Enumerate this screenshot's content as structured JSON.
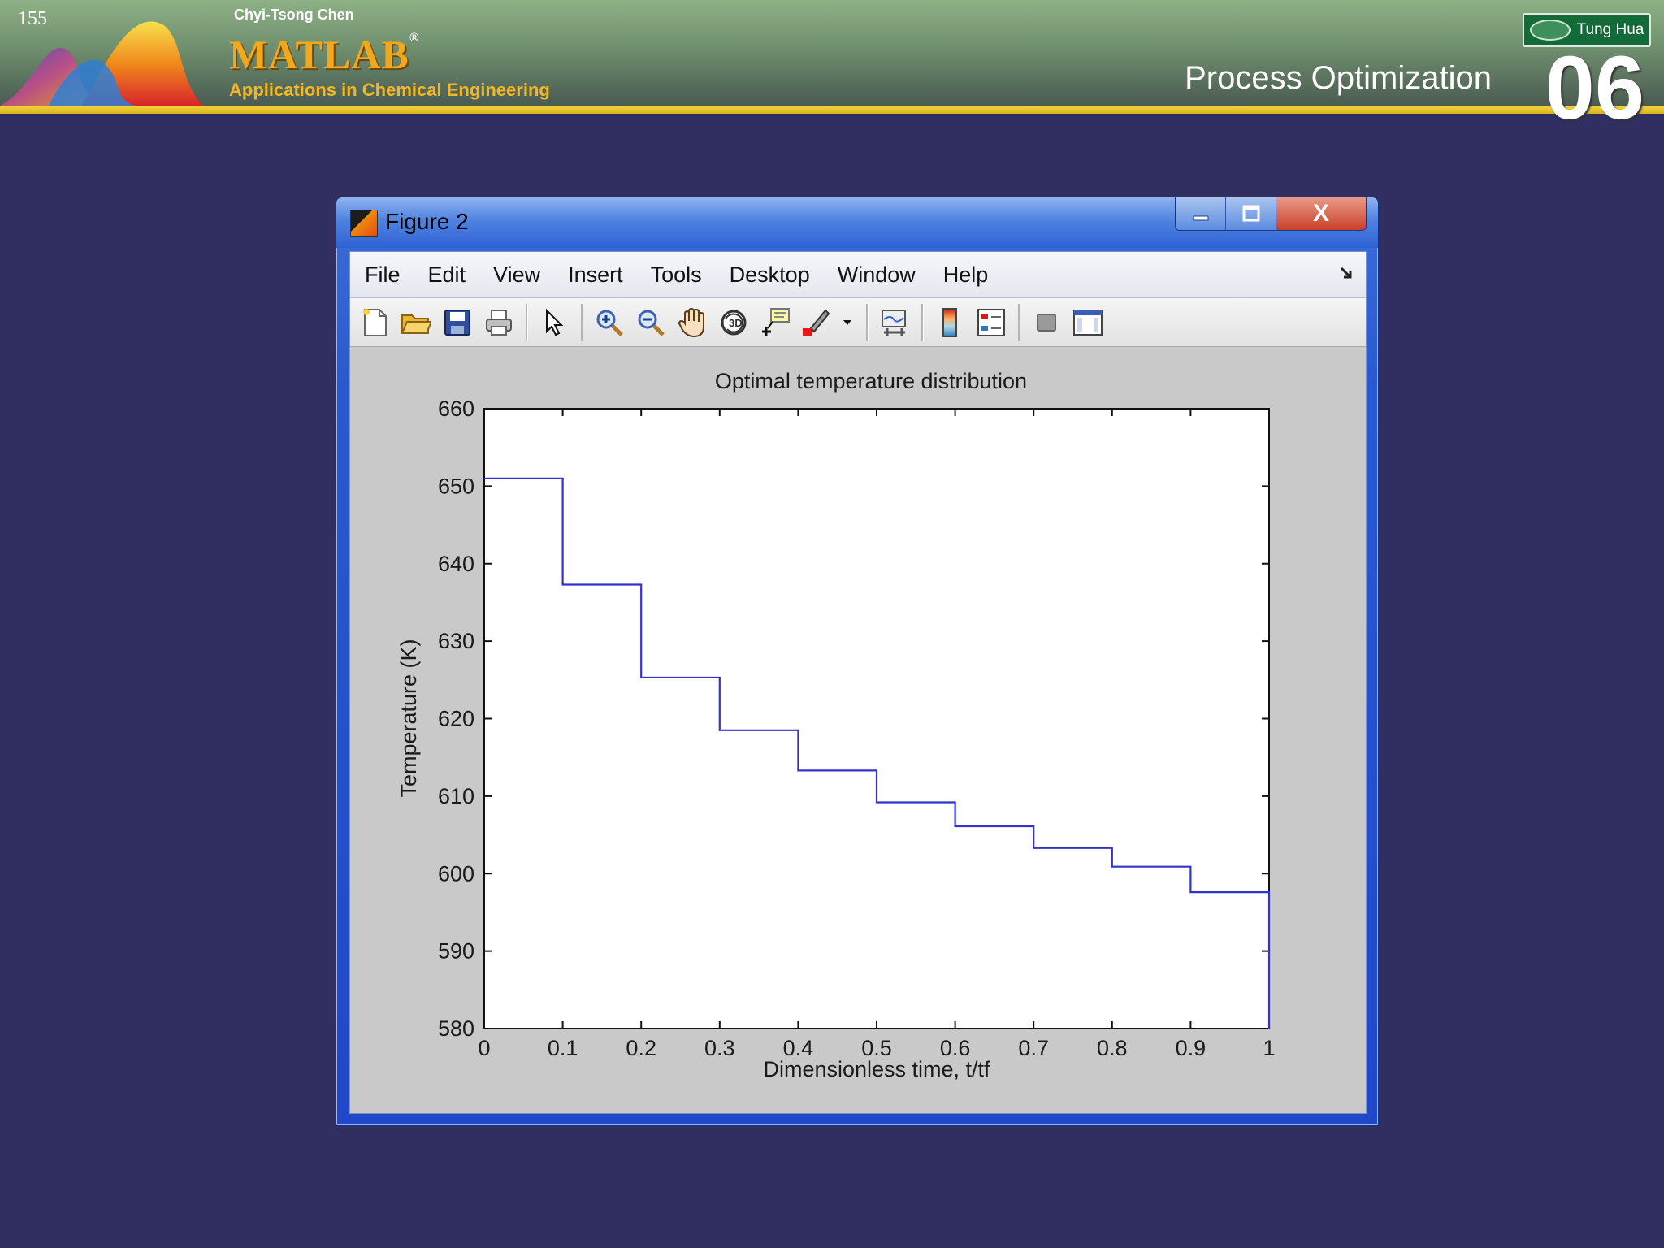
{
  "slide": {
    "page_number": "155",
    "author": "Chyi-Tsong Chen",
    "matlab_title": "MATLAB",
    "matlab_reg": "®",
    "subtitle": "Applications in Chemical Engineering",
    "section_title": "Process Optimization",
    "chapter_number": "06",
    "brand_badge": "Tung Hua"
  },
  "window": {
    "title": "Figure 2",
    "controls": {
      "minimize": "▁",
      "maximize": "☐",
      "close": "X"
    },
    "menu": [
      "File",
      "Edit",
      "View",
      "Insert",
      "Tools",
      "Desktop",
      "Window",
      "Help"
    ],
    "dock_icon": "dock-arrow-icon",
    "toolbar_icons": [
      "new-figure-icon",
      "open-file-icon",
      "save-icon",
      "print-icon",
      "edit-plot-arrow-icon",
      "zoom-in-icon",
      "zoom-out-icon",
      "pan-hand-icon",
      "rotate-3d-icon",
      "data-cursor-icon",
      "brush-icon",
      "brush-dropdown-icon",
      "link-plot-icon",
      "insert-colorbar-icon",
      "insert-legend-icon",
      "hide-plot-tools-icon",
      "show-plot-tools-icon"
    ]
  },
  "chart_data": {
    "type": "line",
    "step": true,
    "title": "Optimal temperature distribution",
    "xlabel": "Dimensionless time, t/tf",
    "ylabel": "Temperature (K)",
    "xlim": [
      0,
      1
    ],
    "ylim": [
      580,
      660
    ],
    "xticks": [
      0,
      0.1,
      0.2,
      0.3,
      0.4,
      0.5,
      0.6,
      0.7,
      0.8,
      0.9,
      1
    ],
    "xtick_labels": [
      "0",
      "0.1",
      "0.2",
      "0.3",
      "0.4",
      "0.5",
      "0.6",
      "0.7",
      "0.8",
      "0.9",
      "1"
    ],
    "yticks": [
      580,
      590,
      600,
      610,
      620,
      630,
      640,
      650,
      660
    ],
    "ytick_labels": [
      "580",
      "590",
      "600",
      "610",
      "620",
      "630",
      "640",
      "650",
      "660"
    ],
    "grid": false,
    "line_color": "#3333cc",
    "series": [
      {
        "x": [
          0,
          0.1,
          0.2,
          0.3,
          0.4,
          0.5,
          0.6,
          0.7,
          0.8,
          0.9,
          1
        ],
        "values": [
          651,
          637.3,
          625.3,
          618.5,
          613.3,
          609.2,
          606.1,
          603.3,
          600.9,
          597.6,
          580
        ]
      }
    ]
  }
}
